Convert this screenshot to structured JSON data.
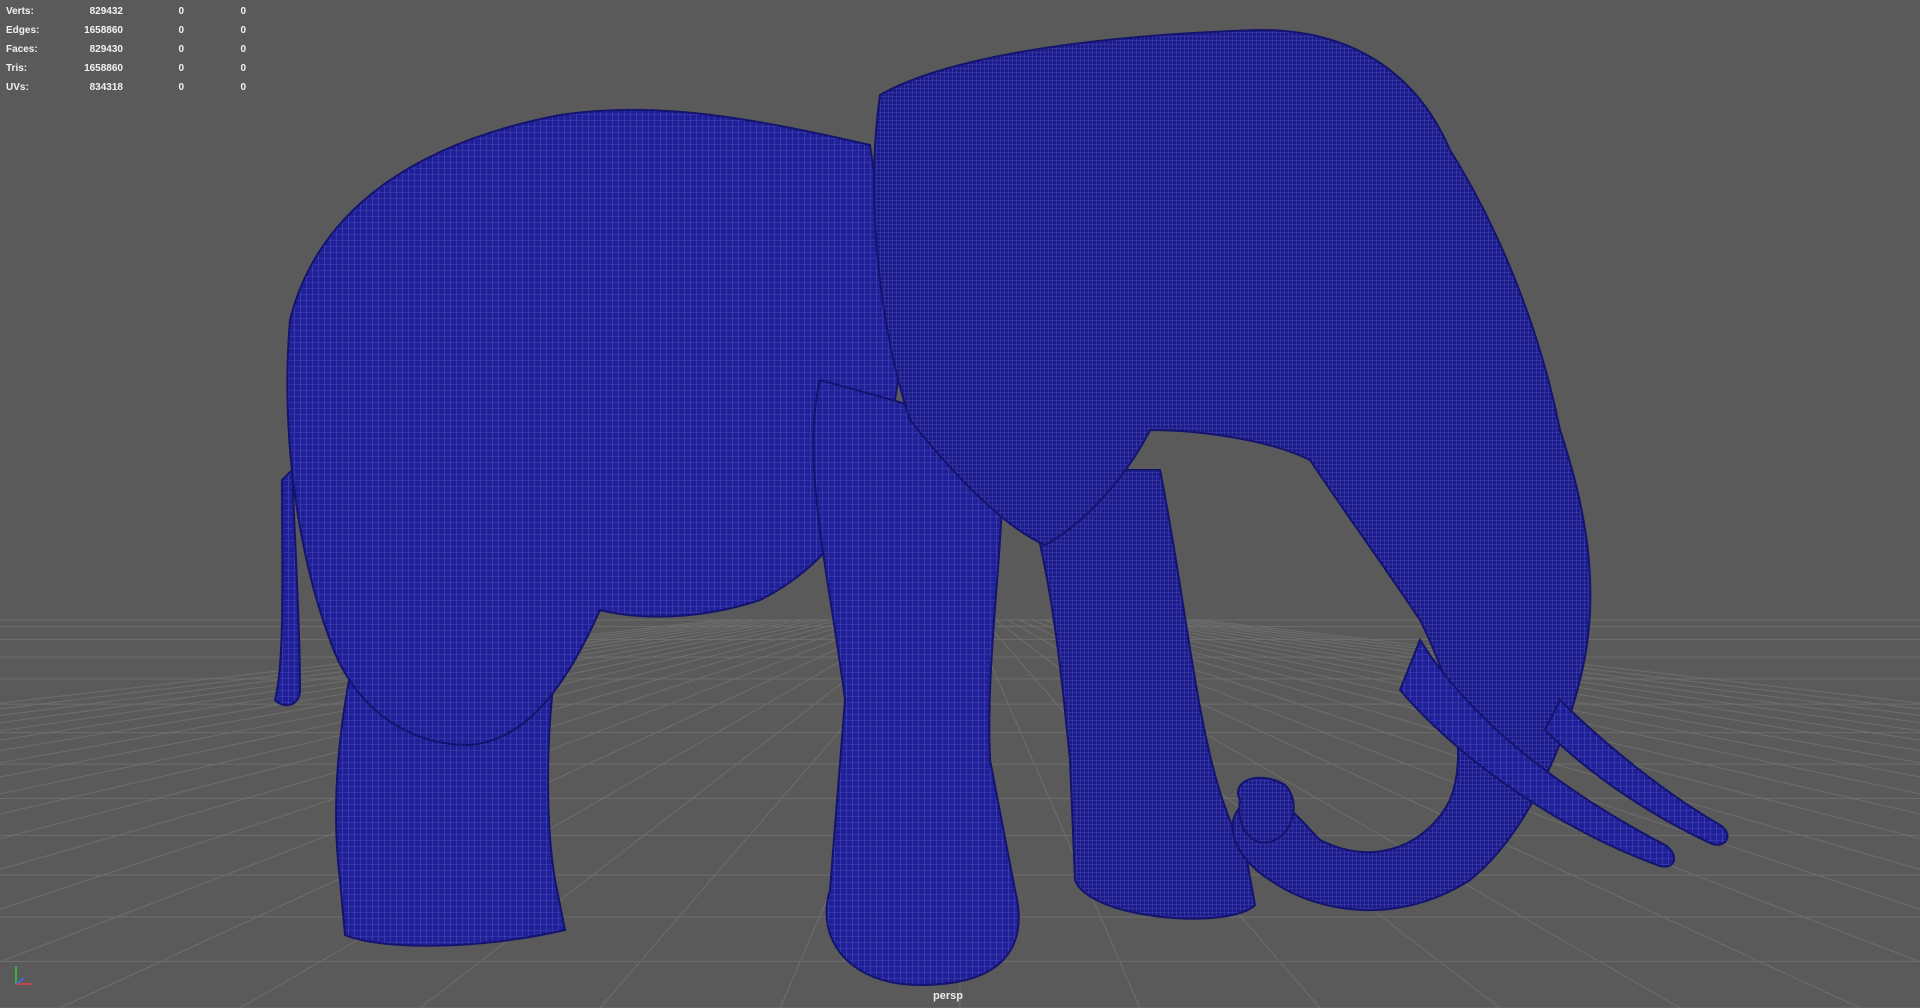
{
  "poly_count": {
    "rows": [
      {
        "label": "Verts:",
        "value": "829432",
        "c1": "0",
        "c2": "0"
      },
      {
        "label": "Edges:",
        "value": "1658860",
        "c1": "0",
        "c2": "0"
      },
      {
        "label": "Faces:",
        "value": "829430",
        "c1": "0",
        "c2": "0"
      },
      {
        "label": "Tris:",
        "value": "1658860",
        "c1": "0",
        "c2": "0"
      },
      {
        "label": "UVs:",
        "value": "834318",
        "c1": "0",
        "c2": "0"
      }
    ]
  },
  "viewport": {
    "camera": "persp",
    "background_color": "#5a5a5a",
    "mesh_color": "#1e1e96",
    "grid_color": "#6e6e6e"
  },
  "scene": {
    "object_icon": "elephant-wireframe-mesh-icon",
    "gizmo_icon": "axis-gizmo-icon"
  }
}
